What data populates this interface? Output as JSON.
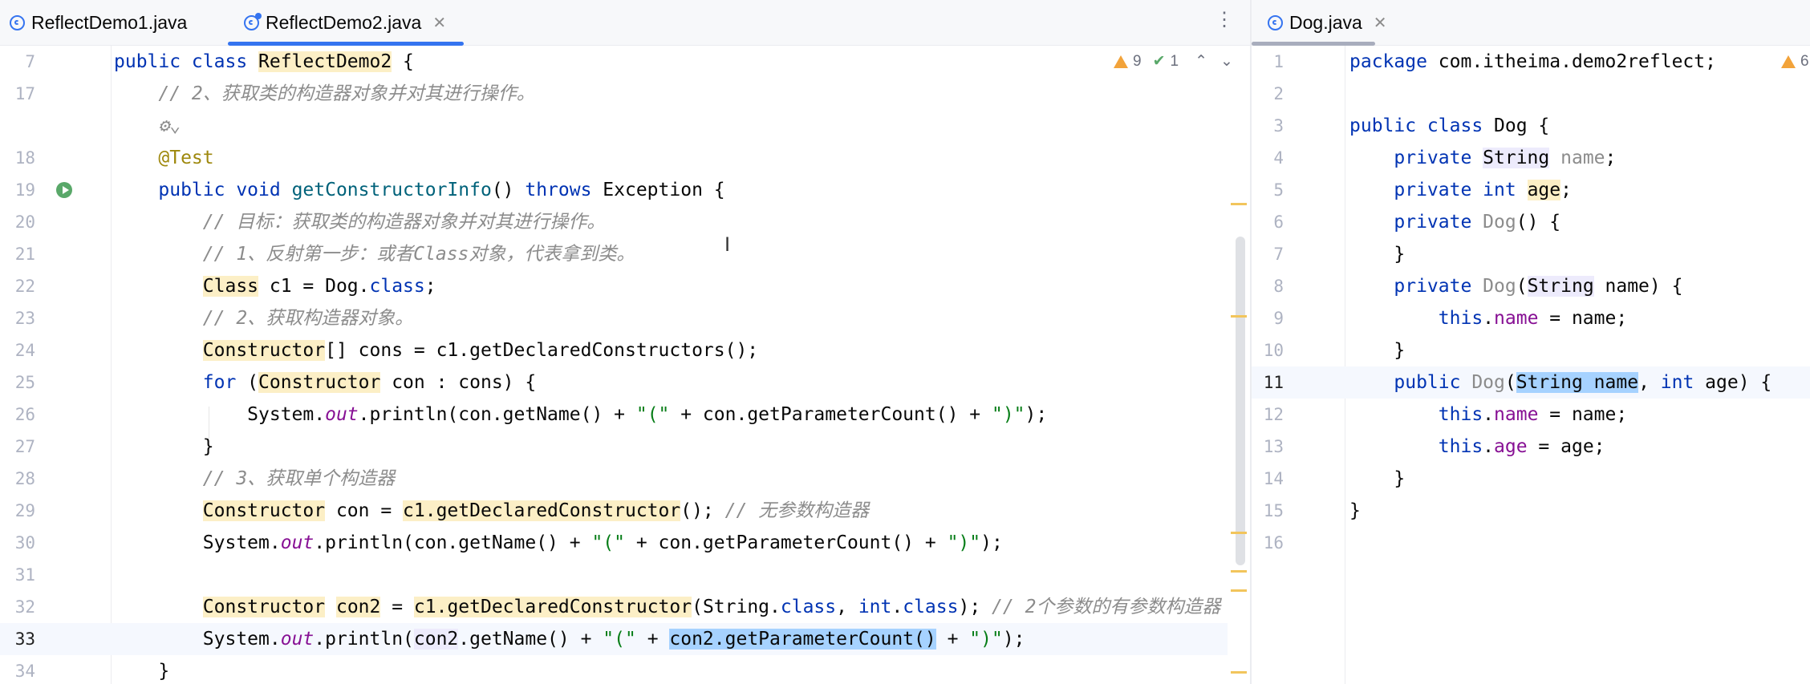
{
  "left_tabs": [
    {
      "label": "ReflectDemo1.java",
      "active": false
    },
    {
      "label": "ReflectDemo2.java",
      "active": true
    }
  ],
  "right_tabs": [
    {
      "label": "Dog.java",
      "active": true
    }
  ],
  "inspections": {
    "warnings": "9",
    "checks": "1"
  },
  "right_inspections": {
    "warnings": "6"
  },
  "colors": {
    "keyword": "#0033b3",
    "comment": "#8c8c8c",
    "string": "#067d17",
    "annotation": "#9e880d",
    "field": "#871094",
    "method_decl": "#00627a",
    "usage_highlight": "#fcefc6",
    "selection": "#a6d2ff",
    "tab_underline": "#3574f0"
  },
  "left_code": [
    {
      "ln": "7",
      "segs": [
        [
          "kw",
          "public class "
        ],
        [
          "hl",
          "ReflectDemo2"
        ],
        [
          "",
          "",
          " {"
        ]
      ]
    },
    {
      "ln": "17",
      "segs": [
        [
          "cm",
          "    // 2、获取类的构造器对象并对其进行操作。"
        ]
      ]
    },
    {
      "ln": "",
      "segs": [
        [
          "cm",
          "    ⚙⌄"
        ]
      ]
    },
    {
      "ln": "18",
      "segs": [
        [
          "an",
          "    @Test"
        ]
      ]
    },
    {
      "ln": "19",
      "segs": [
        [
          "kw",
          "    public void "
        ],
        [
          "fn",
          "getConstructorInfo"
        ],
        [
          "",
          "() "
        ],
        [
          "kw",
          "throws "
        ],
        [
          "",
          "Exception {"
        ]
      ]
    },
    {
      "ln": "20",
      "segs": [
        [
          "cm",
          "        // 目标：获取类的构造器对象并对其进行操作。"
        ]
      ]
    },
    {
      "ln": "21",
      "segs": [
        [
          "cm",
          "        // 1、反射第一步：或者Class对象，代表拿到类。"
        ]
      ]
    },
    {
      "ln": "22",
      "segs": [
        [
          "",
          "        "
        ],
        [
          "hl",
          "Class"
        ],
        [
          "",
          " c1 = Dog."
        ],
        [
          "kw",
          "class"
        ],
        [
          "",
          ";"
        ]
      ]
    },
    {
      "ln": "23",
      "segs": [
        [
          "cm",
          "        // 2、获取构造器对象。"
        ]
      ]
    },
    {
      "ln": "24",
      "segs": [
        [
          "",
          "        "
        ],
        [
          "hl",
          "Constructor"
        ],
        [
          "",
          "[] cons = c1.getDeclaredConstructors();"
        ]
      ]
    },
    {
      "ln": "25",
      "segs": [
        [
          "kw",
          "        for "
        ],
        [
          "",
          "("
        ],
        [
          "hl",
          "Constructor"
        ],
        [
          "",
          " con : cons) {"
        ]
      ]
    },
    {
      "ln": "26",
      "segs": [
        [
          "",
          "            System."
        ],
        [
          "sfld",
          "out"
        ],
        [
          "",
          ".println(con.getName() + "
        ],
        [
          "st",
          "\"(\""
        ],
        [
          "",
          " + con.getParameterCount() + "
        ],
        [
          "st",
          "\")\""
        ],
        [
          "",
          ");"
        ]
      ]
    },
    {
      "ln": "27",
      "segs": [
        [
          "",
          "        }"
        ]
      ]
    },
    {
      "ln": "28",
      "segs": [
        [
          "cm",
          "        // 3、获取单个构造器"
        ]
      ]
    },
    {
      "ln": "29",
      "segs": [
        [
          "",
          "        "
        ],
        [
          "hl",
          "Constructor"
        ],
        [
          "",
          " con = "
        ],
        [
          "hl",
          "c1.getDeclaredConstructor"
        ],
        [
          "",
          "(); "
        ],
        [
          "cm",
          "// 无参数构造器"
        ]
      ]
    },
    {
      "ln": "30",
      "segs": [
        [
          "",
          "        System."
        ],
        [
          "sfld",
          "out"
        ],
        [
          "",
          ".println(con.getName() + "
        ],
        [
          "st",
          "\"(\""
        ],
        [
          "",
          " + con.getParameterCount() + "
        ],
        [
          "st",
          "\")\""
        ],
        [
          "",
          ");"
        ]
      ]
    },
    {
      "ln": "31",
      "segs": [
        [
          "",
          ""
        ]
      ]
    },
    {
      "ln": "32",
      "segs": [
        [
          "",
          "        "
        ],
        [
          "hl",
          "Constructor"
        ],
        [
          "",
          " "
        ],
        [
          "hl",
          "con2"
        ],
        [
          "",
          " = "
        ],
        [
          "hl",
          "c1.getDeclaredConstructor"
        ],
        [
          "",
          "(String."
        ],
        [
          "kw",
          "class"
        ],
        [
          "",
          ", "
        ],
        [
          "kw",
          "int"
        ],
        [
          "",
          "."
        ],
        [
          "kw",
          "class"
        ],
        [
          "",
          "); "
        ],
        [
          "cm",
          "// 2个参数的有参数构造器"
        ]
      ]
    },
    {
      "ln": "33",
      "segs": [
        [
          "",
          "        System."
        ],
        [
          "sfld",
          "out"
        ],
        [
          "",
          ".println("
        ],
        [
          "hl2",
          "con2"
        ],
        [
          "",
          ".getName() + "
        ],
        [
          "st",
          "\"(\""
        ],
        [
          "",
          " + "
        ],
        [
          "sel",
          "con2.getParameterCount()"
        ],
        [
          "",
          " + "
        ],
        [
          "st",
          "\")\""
        ],
        [
          "",
          ");"
        ]
      ]
    },
    {
      "ln": "34",
      "segs": [
        [
          "",
          "    }"
        ]
      ]
    }
  ],
  "right_code": [
    {
      "ln": "1",
      "segs": [
        [
          "kw",
          "package "
        ],
        [
          "",
          "com.itheima.demo2reflect;"
        ]
      ]
    },
    {
      "ln": "2",
      "segs": [
        [
          "",
          ""
        ]
      ]
    },
    {
      "ln": "3",
      "segs": [
        [
          "kw",
          "public class "
        ],
        [
          "",
          "Dog {"
        ]
      ]
    },
    {
      "ln": "4",
      "segs": [
        [
          "kw",
          "    private "
        ],
        [
          "hl2",
          "String"
        ],
        [
          "",
          " "
        ],
        [
          "unused",
          "name"
        ],
        [
          "",
          ";"
        ]
      ]
    },
    {
      "ln": "5",
      "segs": [
        [
          "kw",
          "    private int "
        ],
        [
          "hl",
          "age"
        ],
        [
          "",
          ";"
        ]
      ]
    },
    {
      "ln": "6",
      "segs": [
        [
          "kw",
          "    private "
        ],
        [
          "unused",
          "Dog"
        ],
        [
          "",
          "() {"
        ]
      ]
    },
    {
      "ln": "7",
      "segs": [
        [
          "",
          "    }"
        ]
      ]
    },
    {
      "ln": "8",
      "segs": [
        [
          "kw",
          "    private "
        ],
        [
          "unused",
          "Dog"
        ],
        [
          "",
          "("
        ],
        [
          "hl2",
          "String"
        ],
        [
          "",
          " name) {"
        ]
      ]
    },
    {
      "ln": "9",
      "segs": [
        [
          "kw",
          "        this"
        ],
        [
          "",
          "."
        ],
        [
          "fld",
          "name"
        ],
        [
          "",
          " = name;"
        ]
      ]
    },
    {
      "ln": "10",
      "segs": [
        [
          "",
          "    }"
        ]
      ]
    },
    {
      "ln": "11",
      "segs": [
        [
          "kw",
          "    public "
        ],
        [
          "unused",
          "Dog"
        ],
        [
          "",
          "("
        ],
        [
          "sel",
          "String name"
        ],
        [
          "",
          ", "
        ],
        [
          "kw",
          "int "
        ],
        [
          "",
          "age) {"
        ]
      ]
    },
    {
      "ln": "12",
      "segs": [
        [
          "kw",
          "        this"
        ],
        [
          "",
          "."
        ],
        [
          "fld",
          "name"
        ],
        [
          "",
          " = name;"
        ]
      ]
    },
    {
      "ln": "13",
      "segs": [
        [
          "kw",
          "        this"
        ],
        [
          "",
          "."
        ],
        [
          "fld",
          "age"
        ],
        [
          "",
          " = age;"
        ]
      ]
    },
    {
      "ln": "14",
      "segs": [
        [
          "",
          "    }"
        ]
      ]
    },
    {
      "ln": "15",
      "segs": [
        [
          "",
          "}"
        ]
      ]
    },
    {
      "ln": "16",
      "segs": [
        [
          "",
          ""
        ]
      ]
    }
  ]
}
